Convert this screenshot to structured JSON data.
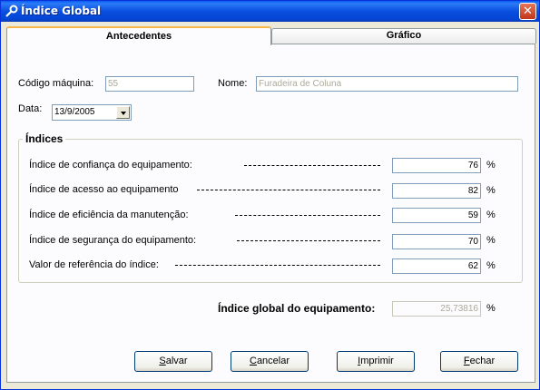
{
  "window": {
    "title": "Índice Global",
    "close_symbol": "✕"
  },
  "tabs": [
    {
      "label": "Antecedentes",
      "active": true
    },
    {
      "label": "Gráfico",
      "active": false
    }
  ],
  "form": {
    "codigo_label": "Código máquina:",
    "codigo_value": "55",
    "nome_label": "Nome:",
    "nome_value": "Furadeira de Coluna",
    "data_label": "Data:",
    "data_value": "13/9/2005"
  },
  "indices": {
    "title": "Índices",
    "unit": "%",
    "rows": [
      {
        "label": "Índice de confiança do equipamento:",
        "value": "76"
      },
      {
        "label": "Índice de acesso ao equipamento",
        "value": "82"
      },
      {
        "label": "Índice de eficiência da manutenção:",
        "value": "59"
      },
      {
        "label": "Índice de segurança do equipamento:",
        "value": "70"
      },
      {
        "label": "Valor de referência do índice:",
        "value": "62"
      }
    ]
  },
  "global": {
    "label": "Índice global do equipamento:",
    "value": "25,73816",
    "unit": "%"
  },
  "buttons": {
    "salvar": {
      "first": "S",
      "rest": "alvar"
    },
    "cancelar": {
      "first": "C",
      "rest": "ancelar"
    },
    "imprimir": {
      "first": "I",
      "rest": "mprimir"
    },
    "fechar": {
      "first": "F",
      "rest": "echar"
    }
  },
  "colors": {
    "titlebar": "#0a4fe0",
    "tab_highlight": "#f7b64a",
    "field_border": "#7f9db9",
    "disabled_text": "#aca899"
  },
  "icons": {
    "title_icon": "tools-icon",
    "combo_arrow": "chevron-down-icon"
  }
}
